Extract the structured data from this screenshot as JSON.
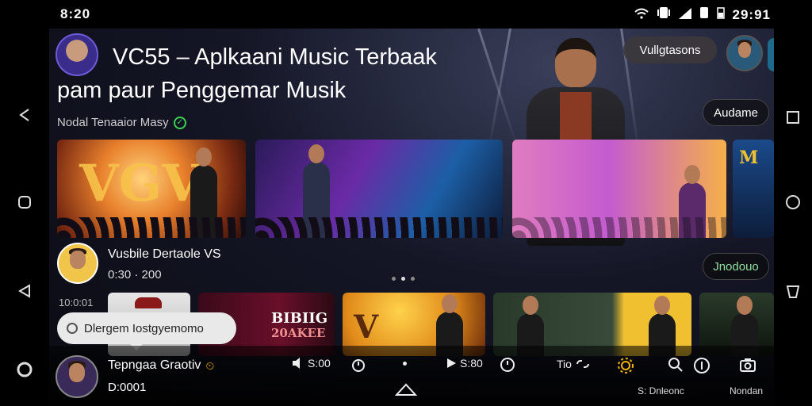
{
  "status": {
    "time": "8:20",
    "clock": "29:91"
  },
  "header": {
    "title_line1": "VC55 – Aplkaani Music Terbaak",
    "title_line2": "pam paur Penggemar Musik",
    "subtitle": "Nodal Tenaaior Masy"
  },
  "buttons": {
    "top_pill": "Vullgtasons",
    "side_pill": "Audame",
    "jnodouo": "Jnodouo"
  },
  "tiles": {
    "tile1_text": "VGV",
    "tile5_text": "BIBIIG",
    "tile5_text2": "20AKEE",
    "tile4_text": "V"
  },
  "now_playing": {
    "title": "Vusbile Dertaole VS",
    "time": "0:30 · 200"
  },
  "row_label": "10:0:01",
  "toast": {
    "text": "Dlergem Iostgyemomo"
  },
  "player": {
    "title": "Tepngaa Graotiv",
    "sub": "D:0001",
    "ctl1": "S:00",
    "ctl2": "S:80",
    "ctl3": "Tio",
    "bottom_label1": "S: Dnleonc",
    "bottom_label2": "Nondan"
  },
  "colors": {
    "accent_green": "#39d353",
    "accent_yellow": "#f0b400",
    "toast_bg": "#e9e9ea"
  }
}
